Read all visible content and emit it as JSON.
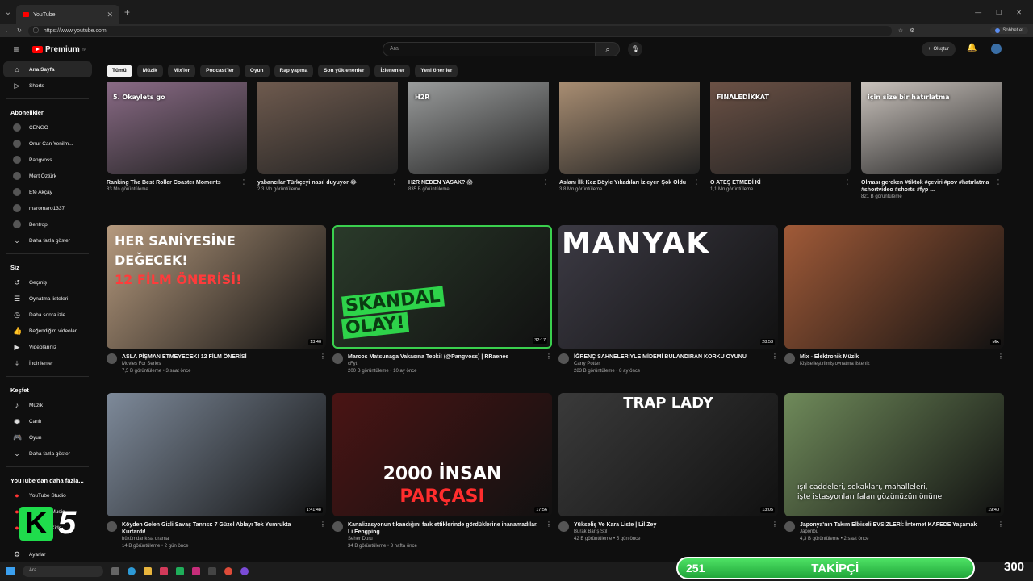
{
  "browser": {
    "tab_title": "YouTube",
    "url": "https://www.youtube.com",
    "chat_button": "Sohbet et"
  },
  "header": {
    "logo_text": "Premium",
    "logo_badge": "TR",
    "search_placeholder": "Ara",
    "create_label": "Oluştur"
  },
  "sidebar": {
    "main": [
      {
        "label": "Ana Sayfa",
        "icon": "home-icon"
      },
      {
        "label": "Shorts",
        "icon": "shorts-icon"
      }
    ],
    "subs_header": "Abonelikler",
    "subs": [
      "CENGO",
      "Onur Can Yenilm...",
      "Pangvoss",
      "Mert Öztürk",
      "Efe Akçay",
      "maromaro1337",
      "Bentropi"
    ],
    "subs_more": "Daha fazla göster",
    "you_header": "Siz",
    "you": [
      {
        "label": "Geçmiş",
        "icon": "history-icon"
      },
      {
        "label": "Oynatma listeleri",
        "icon": "playlist-icon"
      },
      {
        "label": "Daha sonra izle",
        "icon": "watch-later-icon"
      },
      {
        "label": "Beğendiğim videolar",
        "icon": "like-icon"
      },
      {
        "label": "Videolarınız",
        "icon": "video-icon"
      },
      {
        "label": "İndirilenler",
        "icon": "download-icon"
      }
    ],
    "explore_header": "Keşfet",
    "explore": [
      {
        "label": "Müzik",
        "icon": "music-icon"
      },
      {
        "label": "Canlı",
        "icon": "live-icon"
      },
      {
        "label": "Oyun",
        "icon": "gaming-icon"
      },
      {
        "label": "Daha fazla göster",
        "icon": "chevron-down-icon"
      }
    ],
    "more_header": "YouTube'dan daha fazla...",
    "more": [
      "YouTube Studio",
      "YouTube Music",
      "YouTube Kids"
    ],
    "settings": "Ayarlar"
  },
  "chips": [
    "Tümü",
    "Müzik",
    "Mix'ler",
    "Podcast'ler",
    "Oyun",
    "Rap yapma",
    "Son yüklenenler",
    "İzlenenler",
    "Yeni öneriler"
  ],
  "shorts": [
    {
      "title": "Ranking The Best Roller Coaster Moments",
      "views": "83 Mn görüntüleme",
      "bg": "#8a6b86",
      "overlay": "5. Okaylets go"
    },
    {
      "title": "yabancılar Türkçeyi nasıl duyuyor 😂",
      "views": "2,3 Mn görüntüleme",
      "bg": "#6e5a4e",
      "overlay": ""
    },
    {
      "title": "H2R NEDEN YASAK? 😱",
      "views": "835 B görüntüleme",
      "bg": "#9a9c9c",
      "overlay": "H2R"
    },
    {
      "title": "Aslanı İlk Kez Böyle Yıkadıları İzleyen Şok Oldu",
      "views": "3,8 Mn görüntüleme",
      "bg": "#a88d72",
      "overlay": ""
    },
    {
      "title": "O ATEŞ ETMEDİ Kİ",
      "views": "1,1 Mn görüntüleme",
      "bg": "#6b5145",
      "overlay": "FINALEDİKKAT"
    },
    {
      "title": "Olması gereken #tiktok #çeviri #pov #hatırlatma #shortvideo #shorts #fyp ...",
      "views": "821 B görüntüleme",
      "bg": "#c9c2bc",
      "overlay": "için size bir hatırlatma"
    }
  ],
  "row2": [
    {
      "title": "ASLA PİŞMAN ETMEYECEK! 12 FİLM ÖNERİSİ",
      "channel": "Movies For Series",
      "meta": "7,5 B görüntüleme • 3 saat önce",
      "duration": "13:40",
      "bg": "#b69a7e",
      "line1": "HER SANİYESİNE",
      "line2": "DEĞECEK!",
      "line3": "12 FİLM ÖNERİSİ!"
    },
    {
      "title": "Marcos Matsunaga Vakasına Tepki! (@Pangvoss) | RRaenee",
      "channel": "cFyt",
      "meta": "200 B görüntüleme • 10 ay önce",
      "duration": "32:17",
      "bg": "#2a3a2a",
      "line1": "SKANDAL",
      "line2": "OLAY!",
      "line3": ""
    },
    {
      "title": "İĞRENÇ SAHNELERİYLE MİDEMİ BULANDIRAN KORKU OYUNU",
      "channel": "Carry Potter",
      "meta": "283 B görüntüleme • 8 ay önce",
      "duration": "28:53",
      "bg": "#3c3a44",
      "line1": "MANYAK",
      "line2": "",
      "line3": ""
    },
    {
      "title": "Mix - Elektronik Müzik",
      "channel": "Kişiselleştirilmiş oynatma listeniz",
      "meta": "",
      "duration": "Mix",
      "bg": "#a05a38",
      "line1": "",
      "line2": "",
      "line3": ""
    }
  ],
  "row3": [
    {
      "title": "Köyden Gelen Gizli Savaş Tanrısı: 7 Güzel Ablayı Tek Yumrukta Kurtardı!",
      "channel": "hükümdar kısa drama",
      "meta": "14 B görüntüleme • 2 gün önce",
      "duration": "1:41:48",
      "bg": "#7e8a9a",
      "line1": "",
      "line2": ""
    },
    {
      "title": "Kanalizasyonun tıkandığını fark ettiklerinde gördüklerine inanamadılar. Li Fengping",
      "channel": "Seher Duru",
      "meta": "34 B görüntüleme • 3 hafta önce",
      "duration": "17:56",
      "bg": "#4a1414",
      "line1": "2000 İNSAN",
      "line2": "PARÇASI"
    },
    {
      "title": "Yükseliş Ve Kara Liste | Lil Zey",
      "channel": "Burak Barış Stil",
      "meta": "42 B görüntüleme • 5 gün önce",
      "duration": "13:05",
      "bg": "#3a3a3a",
      "line1": "TRAP LADY",
      "line2": ""
    },
    {
      "title": "Japonya'nın Takım Elbiseli EVSİZLERİ: İnternet KAFEDE Yaşamak",
      "channel": "Japonbu",
      "meta": "4,3 B görüntüleme • 2 saat önce",
      "duration": "19:40",
      "bg": "#6f8a5a",
      "line1": "ışıl caddeleri, sokakları, mahalleleri,",
      "line2": "işte istasyonları falan gözünüzün önüne"
    }
  ],
  "taskbar": {
    "search": "Ara"
  },
  "overlay": {
    "follow_current": "251",
    "follow_label": "TAKİPÇİ",
    "follow_goal": "300",
    "k5_letter": "K",
    "k5_number": "5"
  }
}
